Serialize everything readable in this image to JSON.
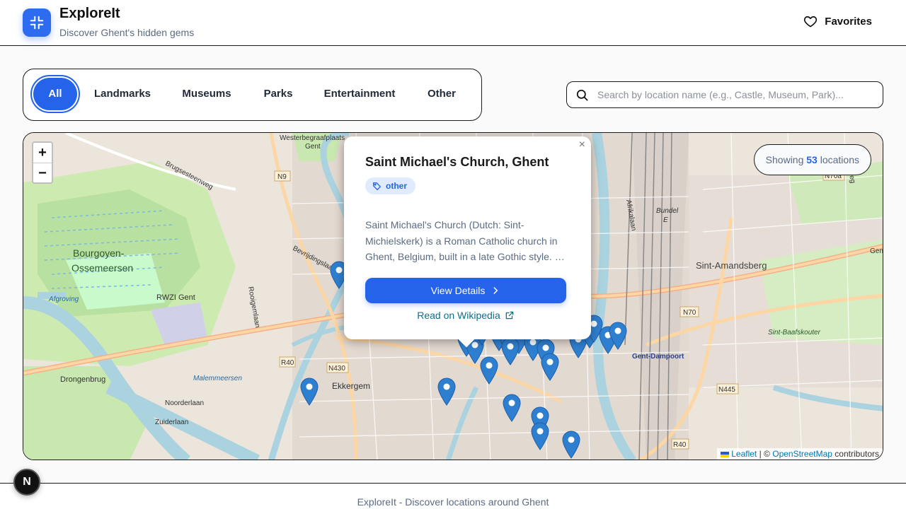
{
  "header": {
    "title": "ExploreIt",
    "subtitle": "Discover Ghent's hidden gems",
    "favorites_label": "Favorites"
  },
  "filters": [
    {
      "label": "All",
      "active": true
    },
    {
      "label": "Landmarks",
      "active": false
    },
    {
      "label": "Museums",
      "active": false
    },
    {
      "label": "Parks",
      "active": false
    },
    {
      "label": "Entertainment",
      "active": false
    },
    {
      "label": "Other",
      "active": false
    }
  ],
  "search": {
    "placeholder": "Search by location name (e.g., Castle, Museum, Park)...",
    "value": ""
  },
  "map": {
    "zoom_in": "+",
    "zoom_out": "−",
    "showing_prefix": "Showing",
    "showing_count": "53",
    "showing_suffix": "locations",
    "attribution": {
      "leaflet": "Leaflet",
      "separator": "| ©",
      "osm": "OpenStreetMap",
      "contributors": "contributors"
    },
    "labels": {
      "bourgoyen": "Bourgoyen-",
      "ossemeersen": "Ossemeersen",
      "sint_amandsberg": "Sint-Amandsberg",
      "ekkergem": "Ekkergem",
      "drongenbrug": "Drongenbrug",
      "westerbegraafplaats": "Westerbegraafplaats",
      "gent_top": "Gent",
      "rwzi": "RWZI Gent",
      "dampoort": "Gent-Dampoort",
      "baafskouter": "Sint-Baafskouter",
      "afgroving": "Afgroving",
      "malemmeersen": "Malemmeersen",
      "noorderlaan": "Noorderlaan",
      "zuiderlaan": "Zuiderlaan",
      "brugsesteenweg": "Brugsesteenweg",
      "bevrijdingslaan": "Bevrijdingslaan",
      "rooigemlaan": "Rooigemlaan",
      "afrikalaan": "Afrikalaan",
      "bundel": "Bundel",
      "bundel_e": "E",
      "n9": "N9",
      "r40_left": "R40",
      "n430": "N430",
      "n70": "N70",
      "n445": "N445",
      "r40_right": "R40",
      "n70a": "N70a",
      "hogeweg": "Hogeweg",
      "gen": "Gen"
    }
  },
  "popup": {
    "close": "×",
    "title": "Saint Michael's Church, Ghent",
    "tag": "other",
    "description": "Saint Michael's Church (Dutch: Sint-Michielskerk) is a Roman Catholic church in Ghent, Belgium, built in a late Gothic style. …",
    "details_label": "View Details",
    "wiki_label": "Read on Wikipedia"
  },
  "footer": {
    "text": "ExploreIt - Discover locations around Ghent"
  },
  "badge": "N",
  "colors": {
    "accent": "#2563eb",
    "marker": "#2f7fd0",
    "water": "#aad3df",
    "park": "#c8facc"
  }
}
